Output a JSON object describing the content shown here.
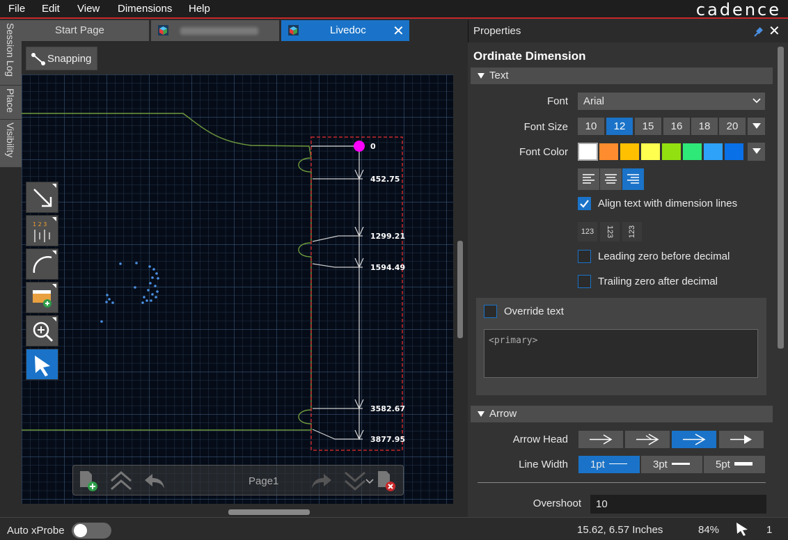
{
  "menubar": {
    "items": [
      "File",
      "Edit",
      "View",
      "Dimensions",
      "Help"
    ],
    "logo": "cadence"
  },
  "side_tabs": [
    "Session Log",
    "Place",
    "Visibility"
  ],
  "doc_tabs": {
    "start_page": "Start Page",
    "livedoc": "Livedoc"
  },
  "canvas": {
    "snapping_label": "Snapping",
    "dimension_labels": [
      "0",
      "452.75",
      "1299.21",
      "1594.49",
      "3582.67",
      "3877.95"
    ],
    "page_select": "Page1"
  },
  "palette": {
    "tools": [
      "diagonal-arrow-icon",
      "ordinate-dimension-icon",
      "arc-icon",
      "add-image-icon",
      "zoom-in-icon",
      "select-pointer-icon"
    ],
    "active_tool": "select-pointer-icon"
  },
  "properties": {
    "panel_title": "Properties",
    "heading": "Ordinate Dimension",
    "text_section": {
      "title": "Text",
      "font_label": "Font",
      "font_value": "Arial",
      "font_size_label": "Font Size",
      "font_sizes": [
        "10",
        "12",
        "15",
        "16",
        "18",
        "20"
      ],
      "font_size_selected": "12",
      "font_color_label": "Font Color",
      "colors": [
        "#ffffff",
        "#ff8c2e",
        "#ffc000",
        "#ffff50",
        "#92e010",
        "#2ee878",
        "#2ea2f8",
        "#0a70e8"
      ],
      "align_text_label": "Align text with dimension lines",
      "align_text_checked": true,
      "orientations": [
        "123",
        "123",
        "123"
      ],
      "leading_zero_label": "Leading zero before decimal",
      "leading_zero_checked": false,
      "trailing_zero_label": "Trailing zero after decimal",
      "trailing_zero_checked": false,
      "override_label": "Override text",
      "override_checked": false,
      "override_value": "<primary>"
    },
    "arrow_section": {
      "title": "Arrow",
      "arrow_head_label": "Arrow Head",
      "line_width_label": "Line Width",
      "line_widths": [
        "1pt",
        "3pt",
        "5pt"
      ],
      "line_width_selected": "1pt",
      "overshoot_label": "Overshoot",
      "overshoot_value": "10"
    }
  },
  "statusbar": {
    "auto_xprobe_label": "Auto xProbe",
    "auto_xprobe_on": false,
    "coordinates": "15.62, 6.57 Inches",
    "zoom": "84%",
    "selection_count": "1"
  }
}
